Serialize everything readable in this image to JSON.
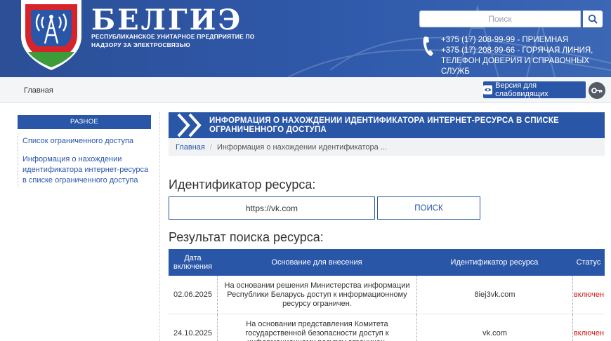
{
  "header": {
    "brand_name": "БЕЛГИЭ",
    "brand_sub": "РЕСПУБЛИКАНСКОЕ УНИТАРНОЕ ПРЕДПРИЯТИЕ ПО НАДЗОРУ ЗА ЭЛЕКТРОСВЯЗЬЮ",
    "search_placeholder": "Поиск",
    "phone_1": "+375 (17) 208-99-99 - ПРИЕМНАЯ",
    "phone_2": "+375 (17) 208-99-66 - ГОРЯЧАЯ ЛИНИЯ,",
    "phone_3": "ТЕЛЕФОН ДОВЕРИЯ И СПРАВОЧНЫХ СЛУЖБ",
    "logo_icon": "radio-tower-shield-logo",
    "search_icon": "search-icon",
    "phone_icon": "phone-icon"
  },
  "nav": {
    "home": "Главная",
    "vision_label": "Версия для слабовидящих",
    "vision_icon": "eye-icon",
    "key_icon": "key-icon"
  },
  "sidebar": {
    "heading": "РАЗНОЕ",
    "items": [
      {
        "label": "Список ограниченного доступа"
      },
      {
        "label": "Информация о нахождении идентификатора интернет-ресурса в списке ограниченного доступа"
      }
    ]
  },
  "main": {
    "banner_title": "ИНФОРМАЦИЯ О НАХОЖДЕНИИ ИДЕНТИФИКАТОРА ИНТЕРНЕТ-РЕСУРСА В СПИСКЕ ОГРАНИЧЕННОГО ДОСТУПА",
    "breadcrumb_home": "Главная",
    "breadcrumb_current": "Информация о нахождении идентификатора ...",
    "identifier_heading": "Идентификатор ресурса:",
    "identifier_value": "https://vk.com",
    "search_button": "ПОИСК",
    "result_heading": "Результат поиска ресурса:"
  },
  "table": {
    "headers": [
      "Дата включения",
      "Основание для внесения",
      "Идентификатор ресурса",
      "Статус"
    ],
    "rows": [
      {
        "date": "02.06.2025",
        "basis": "На основании решения Министерства информации Республики Беларусь доступ к информационному ресурсу ограничен.",
        "resource": "8iej3vk.com",
        "status": "включен"
      },
      {
        "date": "24.10.2025",
        "basis": "На основании представления Комитета государственной безопасности доступ к информационному ресурсу ограничен.",
        "resource": "vk.com",
        "status": "включен"
      }
    ]
  },
  "colors": {
    "primary": "#2a56a8",
    "status_on": "#d11a1a"
  }
}
